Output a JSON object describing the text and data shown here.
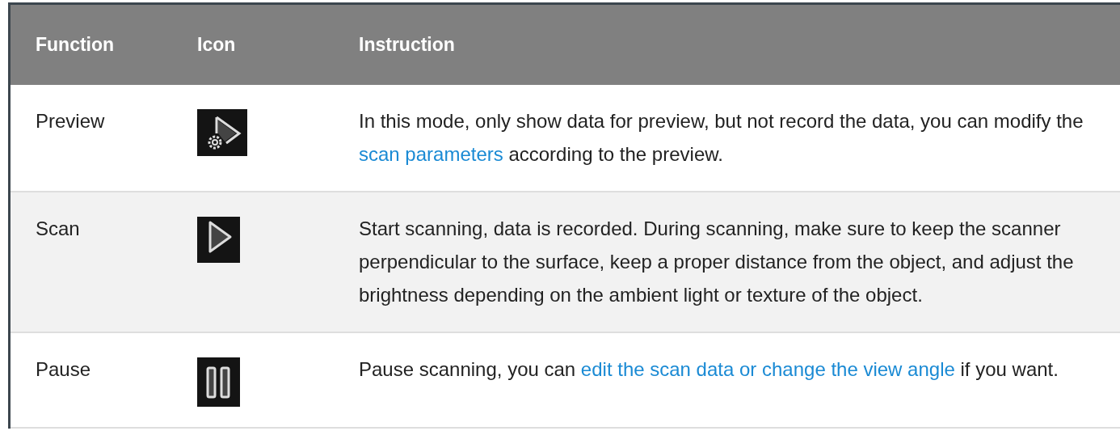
{
  "table": {
    "columns": [
      "Function",
      "Icon",
      "Instruction"
    ],
    "rows": [
      {
        "function": "Preview",
        "kind": "preview",
        "instruction": [
          {
            "kind": "text",
            "text": "In this mode, only show data for preview, but not record the data, you can modify the "
          },
          {
            "kind": "link",
            "text": "scan parameters"
          },
          {
            "kind": "text",
            "text": " according to the preview."
          }
        ]
      },
      {
        "function": "Scan",
        "kind": "scan",
        "instruction": [
          {
            "kind": "text",
            "text": "Start scanning, data is recorded. During scanning, make sure to keep the scanner perpendicular to the surface, keep a proper distance from the object, and adjust the brightness depending on the ambient light or texture of the object."
          }
        ]
      },
      {
        "function": "Pause",
        "kind": "pause",
        "instruction": [
          {
            "kind": "text",
            "text": "Pause scanning, you can "
          },
          {
            "kind": "link",
            "text": "edit the scan data or change the view angle"
          },
          {
            "kind": "text",
            "text": " if you want."
          }
        ]
      }
    ]
  }
}
